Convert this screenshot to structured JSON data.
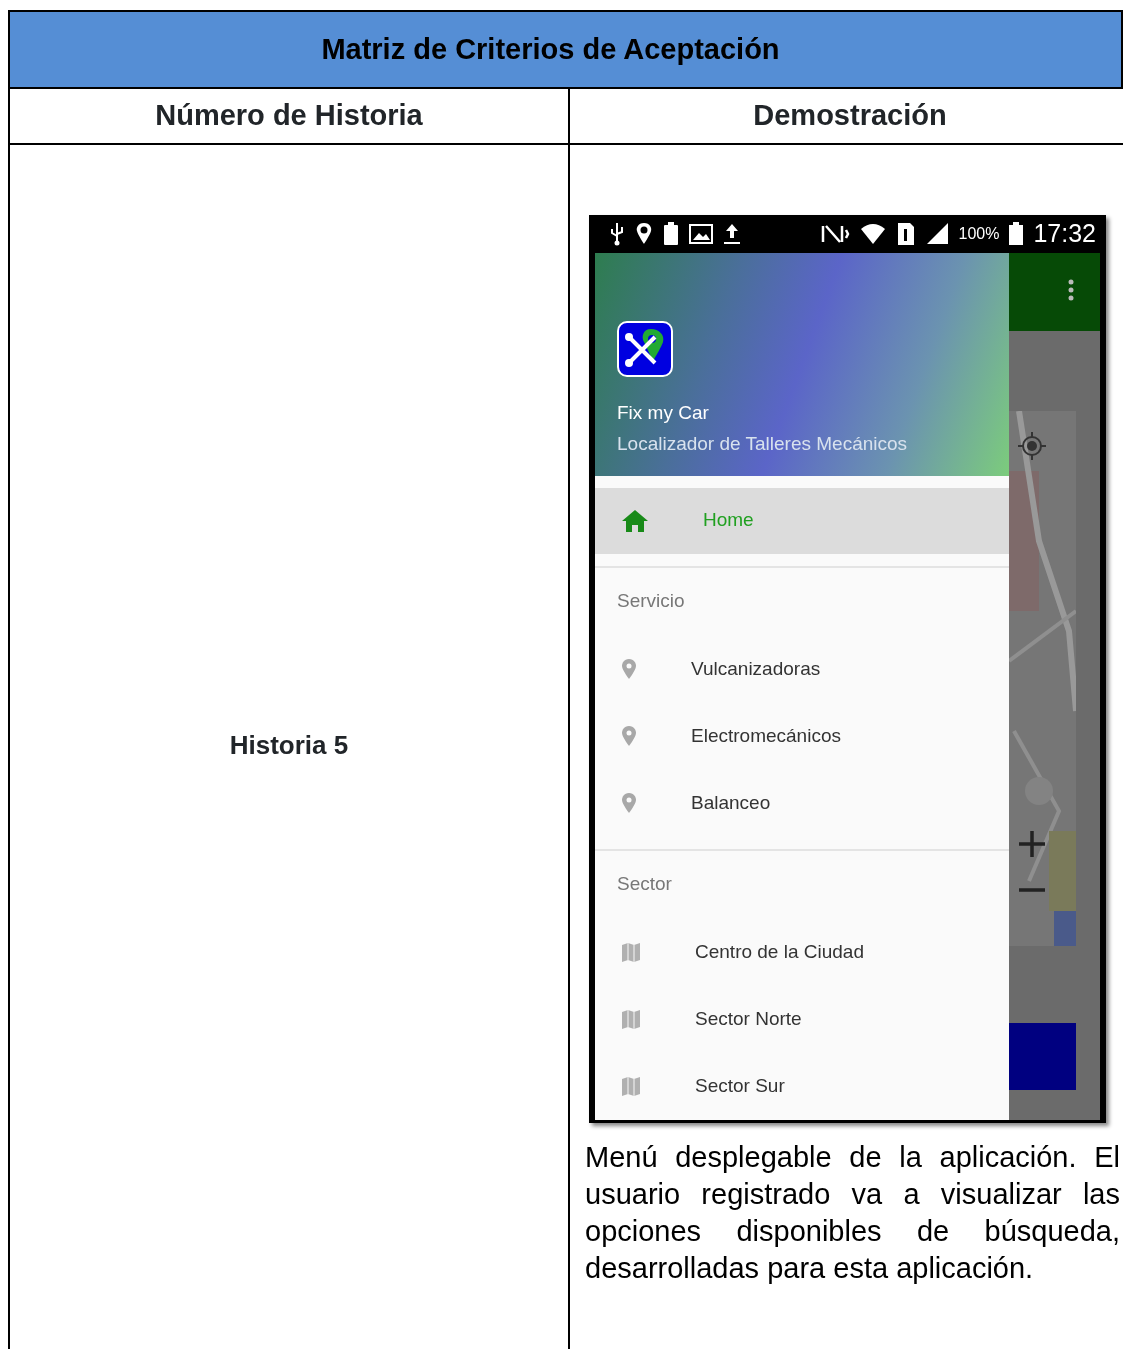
{
  "table": {
    "title": "Matriz de Criterios de Aceptación",
    "columns": [
      "Número de Historia",
      "Demostración"
    ],
    "rows": [
      {
        "story": "Historia 5",
        "screenshot": {
          "status_bar": {
            "battery": "100%",
            "time": "17:32"
          },
          "drawer": {
            "app_name": "Fix my Car",
            "subtitle": "Localizador de Talleres Mecánicos",
            "items": [
              {
                "kind": "home",
                "label": "Home",
                "selected": true
              },
              {
                "kind": "header",
                "label": "Servicio"
              },
              {
                "kind": "place",
                "label": "Vulcanizadoras",
                "selected": false
              },
              {
                "kind": "place",
                "label": "Electromecánicos",
                "selected": false
              },
              {
                "kind": "place",
                "label": "Balanceo",
                "selected": false
              },
              {
                "kind": "header",
                "label": "Sector"
              },
              {
                "kind": "area",
                "label": "Centro de la Ciudad",
                "selected": false
              },
              {
                "kind": "area",
                "label": "Sector Norte",
                "selected": false
              },
              {
                "kind": "area",
                "label": "Sector Sur",
                "selected": false
              }
            ]
          }
        },
        "caption": "Menú desplegable de la aplicación. El usuario registrado va a visualizar las opciones disponibles de búsqueda, desarrolladas para esta aplicación."
      }
    ]
  }
}
